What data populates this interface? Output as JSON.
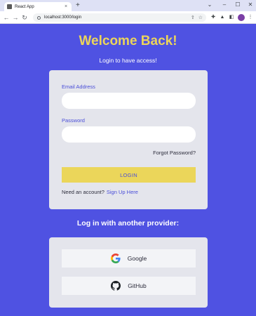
{
  "browser": {
    "tab_title": "React App",
    "tab_close": "×",
    "new_tab": "+",
    "url": "localhost:3000/login",
    "icons": [
      "back-icon",
      "forward-icon",
      "reload-icon",
      "share-icon",
      "star-icon",
      "extensions-icon",
      "profile-icon",
      "menu-icon"
    ]
  },
  "page": {
    "title": "Welcome Back!",
    "subtitle": "Login to have access!",
    "colors": {
      "background": "#4f52e2",
      "accent": "#ecd55a",
      "card": "#e4e5ec",
      "link": "#4a4ed8"
    }
  },
  "login_form": {
    "email_label": "Email Address",
    "email_value": "",
    "password_label": "Password",
    "password_value": "",
    "forgot_password": "Forgot Password?",
    "login_button": "LOGIN",
    "signup_prompt": "Need an account?",
    "signup_link": "Sign Up Here"
  },
  "providers": {
    "heading": "Log in with another provider:",
    "items": [
      {
        "label": "Google",
        "icon": "google-icon"
      },
      {
        "label": "GitHub",
        "icon": "github-icon"
      }
    ]
  }
}
